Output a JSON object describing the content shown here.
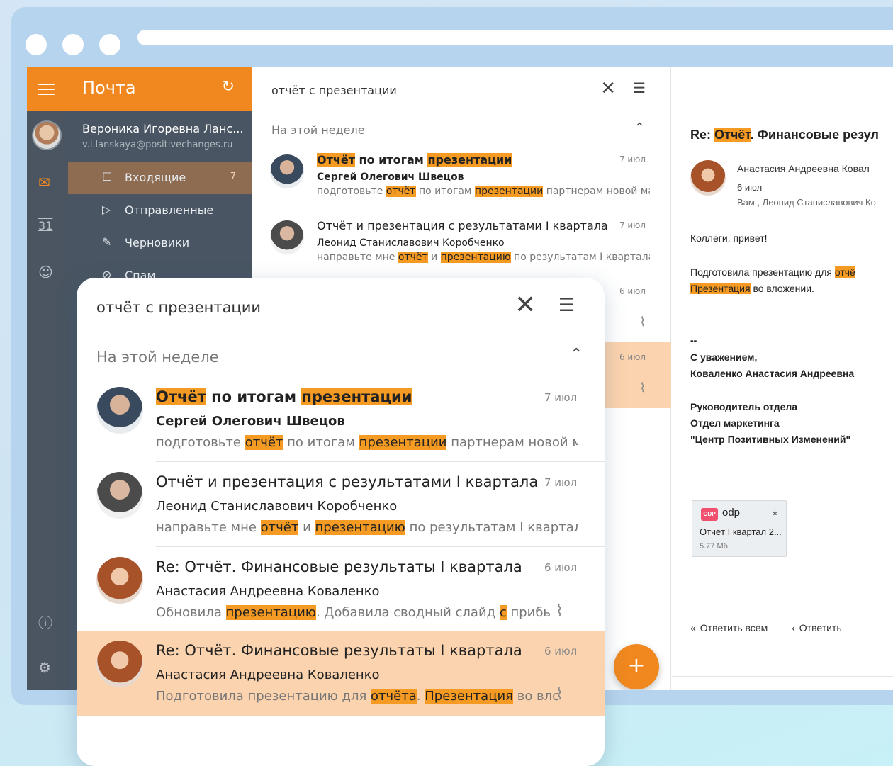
{
  "app": {
    "title": "Почта"
  },
  "search": {
    "query": "отчёт с презентации"
  },
  "section": {
    "label": "На этой неделе"
  },
  "user": {
    "name": "Вероника Игоревна Ланс...",
    "email": "v.i.lanskaya@positivechanges.ru"
  },
  "folders": [
    {
      "label": "Входящие",
      "count": "7",
      "icon": "inbox-icon"
    },
    {
      "label": "Отправленные",
      "icon": "send-icon"
    },
    {
      "label": "Черновики",
      "icon": "draft-icon"
    },
    {
      "label": "Спам",
      "icon": "spam-icon"
    }
  ],
  "messages": [
    {
      "subject_parts": [
        "Отчёт",
        " по итогам ",
        "презентации"
      ],
      "from": "Сергей Олегович Швецов",
      "date": "7 июл",
      "snippet_parts": [
        "подготовьте ",
        "отчёт",
        " по итогам ",
        "презентации",
        " партнерам новой марк"
      ],
      "attachment": false
    },
    {
      "subject_parts": [
        "",
        "Отчёт и презентация с результатами I квартала",
        ""
      ],
      "from": "Леонид Станиславович Коробченко",
      "date": "7 июл",
      "snippet_parts": [
        "направьте мне ",
        "отчёт",
        " и ",
        "презентацию",
        " по результатам I квартала.--"
      ],
      "attachment": false
    },
    {
      "subject_parts": [
        "",
        "Re: Отчёт. Финансовые результаты I квартала",
        ""
      ],
      "from": "Анастасия Андреевна Коваленко",
      "date": "6 июл",
      "snippet_parts": [
        "Обновила ",
        "презентацию",
        ". Добавила сводный слайд ",
        "с",
        " прибь"
      ],
      "attachment": true
    },
    {
      "subject_parts": [
        "",
        "Re: Отчёт. Финансовые результаты I квартала",
        ""
      ],
      "from": "Анастасия Андреевна Коваленко",
      "date": "6 июл",
      "snippet_parts": [
        "Подготовила презентацию для ",
        "отчёта",
        ". ",
        "Презентация",
        " во влс"
      ],
      "attachment": true
    }
  ],
  "reading": {
    "subject_prefix": "Re: ",
    "subject_hl": "Отчёт",
    "subject_rest": ". Финансовые резул",
    "sender": "Анастасия Андреевна Ковал",
    "date": "6 июл",
    "to": "Вам , Леонид Станиславович Ко",
    "greeting": "Коллеги, привет!",
    "line1_text": "Подготовила презентацию для ",
    "line1_hl": "отчё",
    "line2_hl": "Презентация",
    "line2_text": " во вложении.",
    "sig_dash": "--",
    "sig_regards": "С уважением,",
    "sig_name": "Коваленко Анастасия Андреевна",
    "sig_role": "Руководитель отдела",
    "sig_dept": "Отдел маркетинга",
    "sig_org": "\"Центр Позитивных Изменений\"",
    "attachment": {
      "badge": "ODP",
      "ext": "odp",
      "name": "Отчёт I квартал 2...",
      "size": "5.77 Мб"
    },
    "reply_all": "Ответить всем",
    "reply": "Ответить"
  }
}
